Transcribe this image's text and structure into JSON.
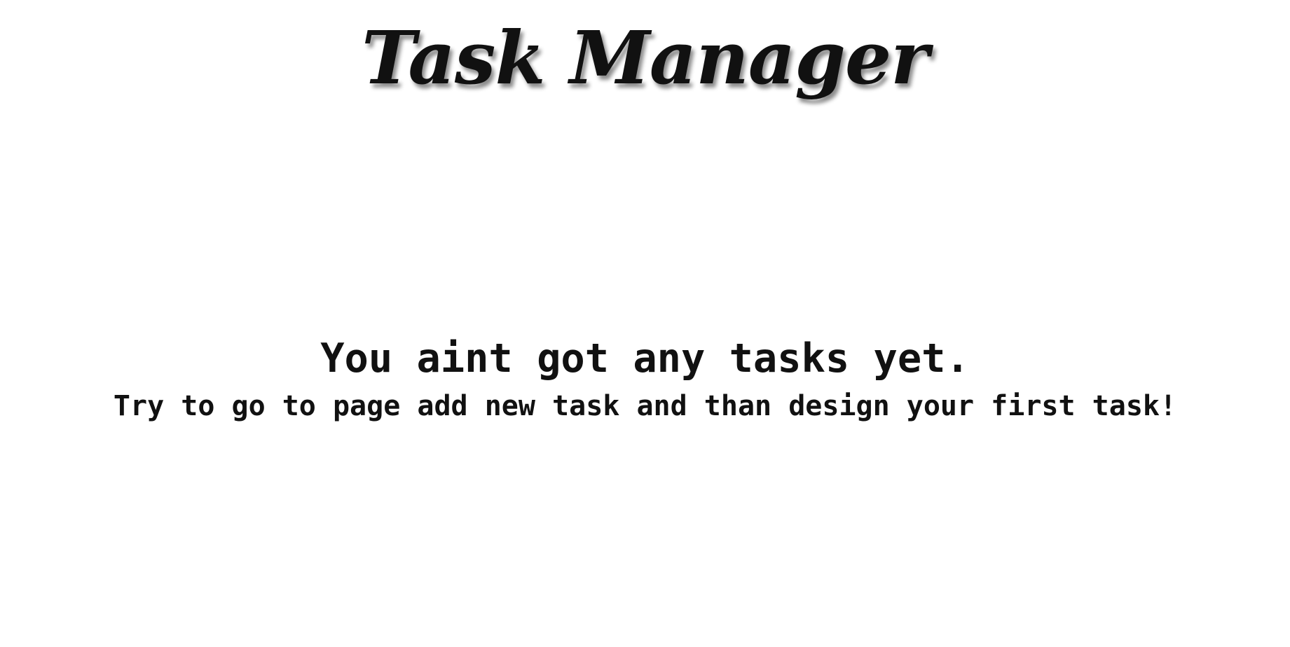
{
  "header": {
    "title": "Task Manager"
  },
  "empty_state": {
    "heading": "You aint got any tasks yet.",
    "hint": "Try to go to page add new task and than design your first task!"
  }
}
